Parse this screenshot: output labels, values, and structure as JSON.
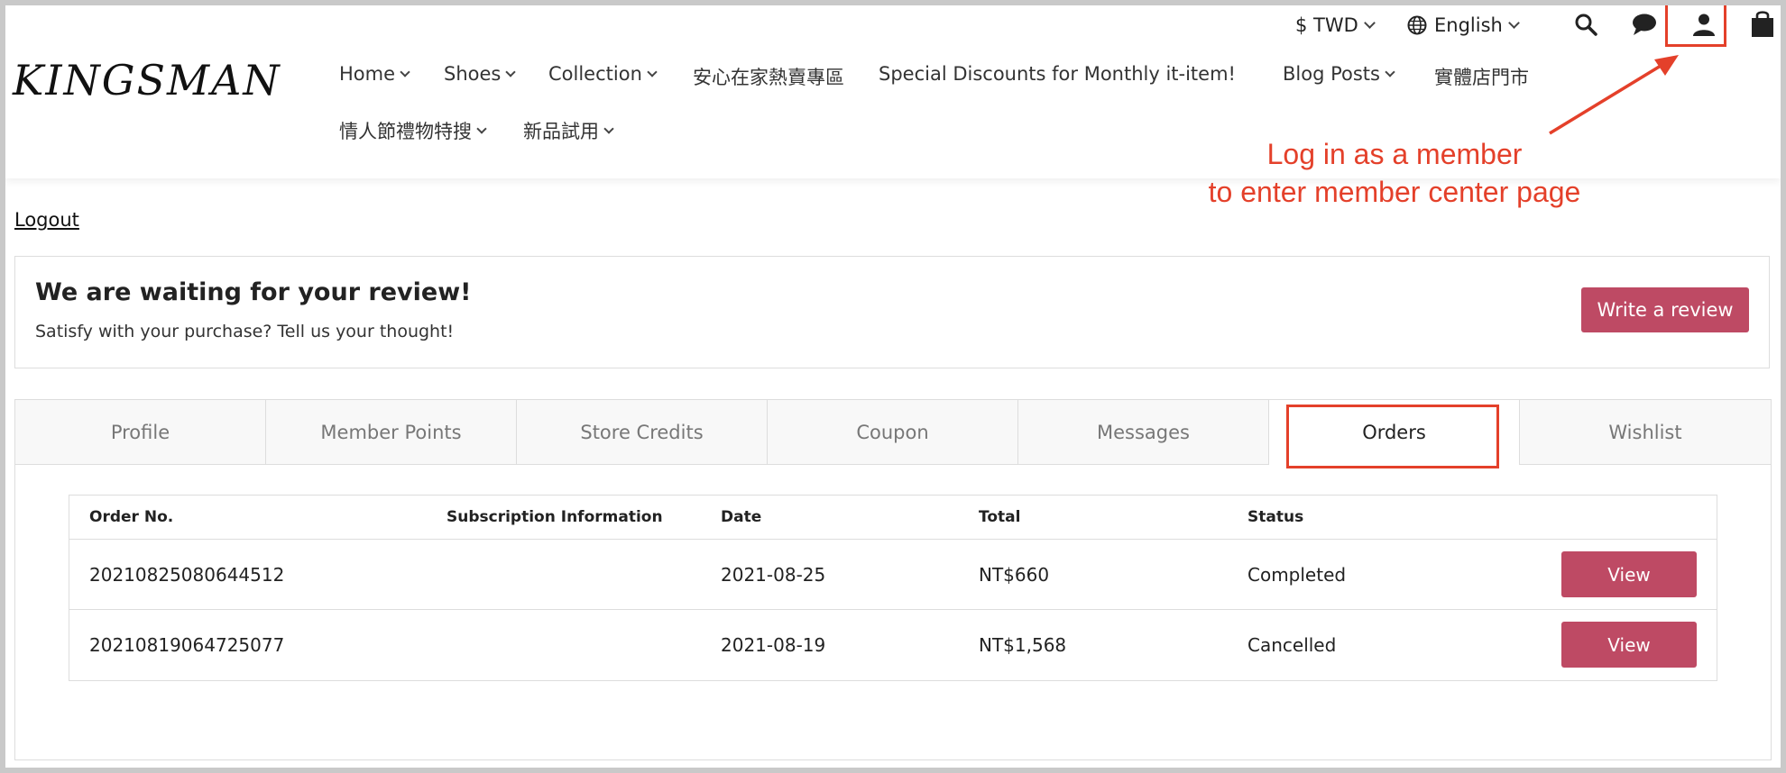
{
  "header": {
    "currency": "$ TWD",
    "language": "English",
    "logo": "KINGSMAN",
    "nav": [
      {
        "label": "Home",
        "dropdown": true
      },
      {
        "label": "Shoes",
        "dropdown": true
      },
      {
        "label": "Collection",
        "dropdown": true
      },
      {
        "label": "安心在家熱賣專區",
        "dropdown": false
      },
      {
        "label": "Special Discounts for Monthly it-item!",
        "dropdown": false
      },
      {
        "label": "Blog Posts",
        "dropdown": true
      },
      {
        "label": "實體店門市",
        "dropdown": false
      },
      {
        "label": "情人節禮物特搜",
        "dropdown": true
      },
      {
        "label": "新品試用",
        "dropdown": true
      }
    ],
    "icons": [
      "globe-icon",
      "search-icon",
      "chat-icon",
      "user-icon",
      "shopping-bag-icon"
    ]
  },
  "annotation": {
    "line1": "Log in as a member",
    "line2": "to enter member center page",
    "color": "#e4402a"
  },
  "logout_label": "Logout",
  "review_banner": {
    "title": "We are waiting for your review!",
    "subtitle": "Satisfy with your purchase? Tell us your thought!",
    "button": "Write a review"
  },
  "tabs": [
    "Profile",
    "Member Points",
    "Store Credits",
    "Coupon",
    "Messages",
    "Orders",
    "Wishlist"
  ],
  "active_tab": "Orders",
  "orders": {
    "columns": [
      "Order No.",
      "Subscription Information",
      "Date",
      "Total",
      "Status"
    ],
    "rows": [
      {
        "order_no": "20210825080644512",
        "subscription": "",
        "date": "2021-08-25",
        "total": "NT$660",
        "status": "Completed",
        "action": "View"
      },
      {
        "order_no": "20210819064725077",
        "subscription": "",
        "date": "2021-08-19",
        "total": "NT$1,568",
        "status": "Cancelled",
        "action": "View"
      }
    ]
  },
  "colors": {
    "accent": "#be4a64",
    "annotation": "#e4402a"
  }
}
